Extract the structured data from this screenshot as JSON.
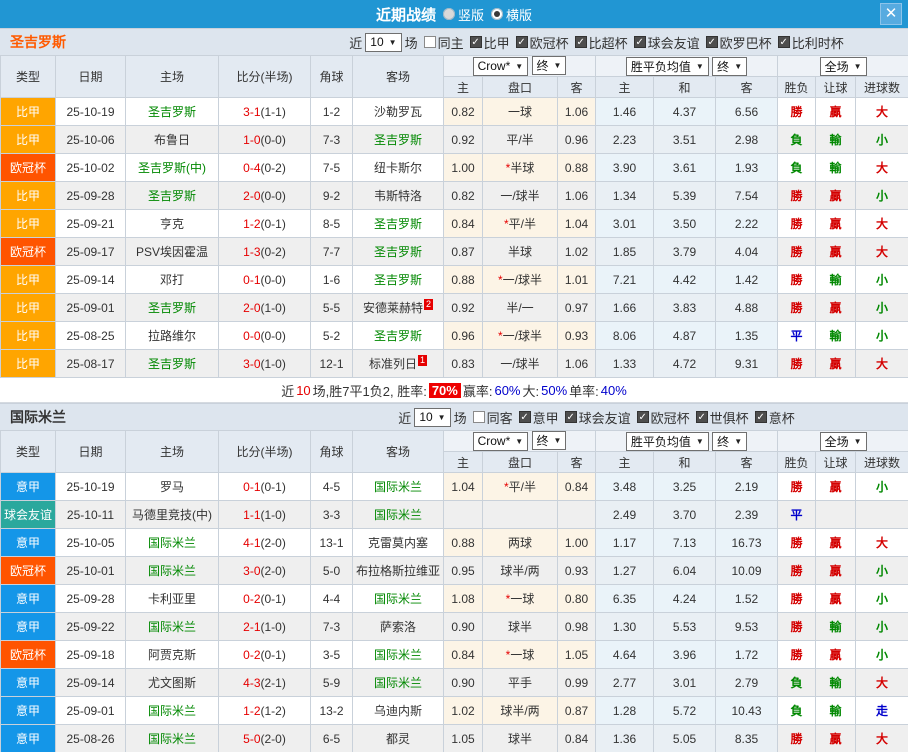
{
  "titlebar": {
    "title": "近期战绩",
    "vertical": "竖版",
    "horizontal": "横版",
    "close": "✕"
  },
  "labels": {
    "near": "近",
    "games": "场"
  },
  "table_header": {
    "cols": [
      "类型",
      "日期",
      "主场",
      "比分(半场)",
      "角球",
      "客场"
    ],
    "sub": [
      "主",
      "盘口",
      "客",
      "主",
      "和",
      "客",
      "胜负",
      "让球",
      "进球数"
    ],
    "crow": "Crow*",
    "final": "终",
    "avg": "胜平负均值",
    "full": "全场"
  },
  "focus_team_color": "#008800",
  "type_colors": {
    "比甲": "#ffa500",
    "欧冠杯": "#ff5400",
    "意甲": "#1496e8",
    "球会友谊": "#2aa89d"
  },
  "result_colors": {
    "勝": "#d40000",
    "負": "#008800",
    "平": "#0000cc",
    "贏": "#d40000",
    "輸": "#008800",
    "大": "#d40000",
    "小": "#008800",
    "走": "#0000cc"
  },
  "sections": [
    {
      "team": "圣吉罗斯",
      "team_color": "#ff5a00",
      "count": "10",
      "same_label": "同主",
      "leagues": [
        "比甲",
        "欧冠杯",
        "比超杯",
        "球会友谊",
        "欧罗巴杯",
        "比利时杯"
      ],
      "rows": [
        {
          "type": "比甲",
          "date": "25-10-19",
          "home": "圣吉罗斯",
          "home_focus": true,
          "ft": "3-1",
          "ht": "(1-1)",
          "corner": "1-2",
          "away": "沙勒罗瓦",
          "away_focus": false,
          "away_badge": "",
          "o1": "0.82",
          "handicap": "一球",
          "o2": "1.06",
          "avg_win": "1.46",
          "avg_draw": "4.37",
          "avg_lose": "6.56",
          "wdl": "勝",
          "let": "贏",
          "goals": "大"
        },
        {
          "type": "比甲",
          "date": "25-10-06",
          "home": "布鲁日",
          "home_focus": false,
          "ft": "1-0",
          "ht": "(0-0)",
          "corner": "7-3",
          "away": "圣吉罗斯",
          "away_focus": true,
          "away_badge": "",
          "o1": "0.92",
          "handicap": "平/半",
          "o2": "0.96",
          "avg_win": "2.23",
          "avg_draw": "3.51",
          "avg_lose": "2.98",
          "wdl": "負",
          "let": "輸",
          "goals": "小"
        },
        {
          "type": "欧冠杯",
          "date": "25-10-02",
          "home": "圣吉罗斯(中)",
          "home_focus": true,
          "ft": "0-4",
          "ht": "(0-2)",
          "corner": "7-5",
          "away": "纽卡斯尔",
          "away_focus": false,
          "away_badge": "",
          "o1": "1.00",
          "handicap": "*半球",
          "o2": "0.88",
          "avg_win": "3.90",
          "avg_draw": "3.61",
          "avg_lose": "1.93",
          "wdl": "負",
          "let": "輸",
          "goals": "大"
        },
        {
          "type": "比甲",
          "date": "25-09-28",
          "home": "圣吉罗斯",
          "home_focus": true,
          "ft": "2-0",
          "ht": "(0-0)",
          "corner": "9-2",
          "away": "韦斯特洛",
          "away_focus": false,
          "away_badge": "",
          "o1": "0.82",
          "handicap": "一/球半",
          "o2": "1.06",
          "avg_win": "1.34",
          "avg_draw": "5.39",
          "avg_lose": "7.54",
          "wdl": "勝",
          "let": "贏",
          "goals": "小"
        },
        {
          "type": "比甲",
          "date": "25-09-21",
          "home": "亨克",
          "home_focus": false,
          "ft": "1-2",
          "ht": "(0-1)",
          "corner": "8-5",
          "away": "圣吉罗斯",
          "away_focus": true,
          "away_badge": "",
          "o1": "0.84",
          "handicap": "*平/半",
          "o2": "1.04",
          "avg_win": "3.01",
          "avg_draw": "3.50",
          "avg_lose": "2.22",
          "wdl": "勝",
          "let": "贏",
          "goals": "大"
        },
        {
          "type": "欧冠杯",
          "date": "25-09-17",
          "home": "PSV埃因霍温",
          "home_focus": false,
          "ft": "1-3",
          "ht": "(0-2)",
          "corner": "7-7",
          "away": "圣吉罗斯",
          "away_focus": true,
          "away_badge": "",
          "o1": "0.87",
          "handicap": "半球",
          "o2": "1.02",
          "avg_win": "1.85",
          "avg_draw": "3.79",
          "avg_lose": "4.04",
          "wdl": "勝",
          "let": "贏",
          "goals": "大"
        },
        {
          "type": "比甲",
          "date": "25-09-14",
          "home": "邓打",
          "home_focus": false,
          "ft": "0-1",
          "ht": "(0-0)",
          "corner": "1-6",
          "away": "圣吉罗斯",
          "away_focus": true,
          "away_badge": "",
          "o1": "0.88",
          "handicap": "*一/球半",
          "o2": "1.01",
          "avg_win": "7.21",
          "avg_draw": "4.42",
          "avg_lose": "1.42",
          "wdl": "勝",
          "let": "輸",
          "goals": "小"
        },
        {
          "type": "比甲",
          "date": "25-09-01",
          "home": "圣吉罗斯",
          "home_focus": true,
          "ft": "2-0",
          "ht": "(1-0)",
          "corner": "5-5",
          "away": "安德莱赫特",
          "away_focus": false,
          "away_badge": "2",
          "o1": "0.92",
          "handicap": "半/一",
          "o2": "0.97",
          "avg_win": "1.66",
          "avg_draw": "3.83",
          "avg_lose": "4.88",
          "wdl": "勝",
          "let": "贏",
          "goals": "小"
        },
        {
          "type": "比甲",
          "date": "25-08-25",
          "home": "拉路维尔",
          "home_focus": false,
          "ft": "0-0",
          "ht": "(0-0)",
          "corner": "5-2",
          "away": "圣吉罗斯",
          "away_focus": true,
          "away_badge": "",
          "o1": "0.96",
          "handicap": "*一/球半",
          "o2": "0.93",
          "avg_win": "8.06",
          "avg_draw": "4.87",
          "avg_lose": "1.35",
          "wdl": "平",
          "let": "輸",
          "goals": "小"
        },
        {
          "type": "比甲",
          "date": "25-08-17",
          "home": "圣吉罗斯",
          "home_focus": true,
          "ft": "3-0",
          "ht": "(1-0)",
          "corner": "12-1",
          "away": "标准列日",
          "away_focus": false,
          "away_badge": "1",
          "o1": "0.83",
          "handicap": "一/球半",
          "o2": "1.06",
          "avg_win": "1.33",
          "avg_draw": "4.72",
          "avg_lose": "9.31",
          "wdl": "勝",
          "let": "贏",
          "goals": "大"
        }
      ],
      "summary": {
        "pre": "近",
        "count": "10",
        "mid": "场,胜7平1负2, 胜率:",
        "rate": "70%",
        "win_label": "赢率:",
        "win": "60%",
        "big_label": "大:",
        "big": "50%",
        "single_label": "单率:",
        "single": "40%"
      }
    },
    {
      "team": "国际米兰",
      "team_color": "#333333",
      "count": "10",
      "same_label": "同客",
      "leagues": [
        "意甲",
        "球会友谊",
        "欧冠杯",
        "世俱杯",
        "意杯"
      ],
      "rows": [
        {
          "type": "意甲",
          "date": "25-10-19",
          "home": "罗马",
          "home_focus": false,
          "ft": "0-1",
          "ht": "(0-1)",
          "corner": "4-5",
          "away": "国际米兰",
          "away_focus": true,
          "away_badge": "",
          "o1": "1.04",
          "handicap": "*平/半",
          "o2": "0.84",
          "avg_win": "3.48",
          "avg_draw": "3.25",
          "avg_lose": "2.19",
          "wdl": "勝",
          "let": "贏",
          "goals": "小"
        },
        {
          "type": "球会友谊",
          "date": "25-10-11",
          "home": "马德里竞技(中)",
          "home_focus": false,
          "ft": "1-1",
          "ht": "(1-0)",
          "corner": "3-3",
          "away": "国际米兰",
          "away_focus": true,
          "away_badge": "",
          "o1": "",
          "handicap": "",
          "o2": "",
          "avg_win": "2.49",
          "avg_draw": "3.70",
          "avg_lose": "2.39",
          "wdl": "平",
          "let": "",
          "goals": ""
        },
        {
          "type": "意甲",
          "date": "25-10-05",
          "home": "国际米兰",
          "home_focus": true,
          "ft": "4-1",
          "ht": "(2-0)",
          "corner": "13-1",
          "away": "克雷莫内塞",
          "away_focus": false,
          "away_badge": "",
          "o1": "0.88",
          "handicap": "两球",
          "o2": "1.00",
          "avg_win": "1.17",
          "avg_draw": "7.13",
          "avg_lose": "16.73",
          "wdl": "勝",
          "let": "贏",
          "goals": "大"
        },
        {
          "type": "欧冠杯",
          "date": "25-10-01",
          "home": "国际米兰",
          "home_focus": true,
          "ft": "3-0",
          "ht": "(2-0)",
          "corner": "5-0",
          "away": "布拉格斯拉维亚",
          "away_focus": false,
          "away_badge": "",
          "o1": "0.95",
          "handicap": "球半/两",
          "o2": "0.93",
          "avg_win": "1.27",
          "avg_draw": "6.04",
          "avg_lose": "10.09",
          "wdl": "勝",
          "let": "贏",
          "goals": "小"
        },
        {
          "type": "意甲",
          "date": "25-09-28",
          "home": "卡利亚里",
          "home_focus": false,
          "ft": "0-2",
          "ht": "(0-1)",
          "corner": "4-4",
          "away": "国际米兰",
          "away_focus": true,
          "away_badge": "",
          "o1": "1.08",
          "handicap": "*一球",
          "o2": "0.80",
          "avg_win": "6.35",
          "avg_draw": "4.24",
          "avg_lose": "1.52",
          "wdl": "勝",
          "let": "贏",
          "goals": "小"
        },
        {
          "type": "意甲",
          "date": "25-09-22",
          "home": "国际米兰",
          "home_focus": true,
          "ft": "2-1",
          "ht": "(1-0)",
          "corner": "7-3",
          "away": "萨索洛",
          "away_focus": false,
          "away_badge": "",
          "o1": "0.90",
          "handicap": "球半",
          "o2": "0.98",
          "avg_win": "1.30",
          "avg_draw": "5.53",
          "avg_lose": "9.53",
          "wdl": "勝",
          "let": "輸",
          "goals": "小"
        },
        {
          "type": "欧冠杯",
          "date": "25-09-18",
          "home": "阿贾克斯",
          "home_focus": false,
          "ft": "0-2",
          "ht": "(0-1)",
          "corner": "3-5",
          "away": "国际米兰",
          "away_focus": true,
          "away_badge": "",
          "o1": "0.84",
          "handicap": "*一球",
          "o2": "1.05",
          "avg_win": "4.64",
          "avg_draw": "3.96",
          "avg_lose": "1.72",
          "wdl": "勝",
          "let": "贏",
          "goals": "小"
        },
        {
          "type": "意甲",
          "date": "25-09-14",
          "home": "尤文图斯",
          "home_focus": false,
          "ft": "4-3",
          "ht": "(2-1)",
          "corner": "5-9",
          "away": "国际米兰",
          "away_focus": true,
          "away_badge": "",
          "o1": "0.90",
          "handicap": "平手",
          "o2": "0.99",
          "avg_win": "2.77",
          "avg_draw": "3.01",
          "avg_lose": "2.79",
          "wdl": "負",
          "let": "輸",
          "goals": "大"
        },
        {
          "type": "意甲",
          "date": "25-09-01",
          "home": "国际米兰",
          "home_focus": true,
          "ft": "1-2",
          "ht": "(1-2)",
          "corner": "13-2",
          "away": "乌迪内斯",
          "away_focus": false,
          "away_badge": "",
          "o1": "1.02",
          "handicap": "球半/两",
          "o2": "0.87",
          "avg_win": "1.28",
          "avg_draw": "5.72",
          "avg_lose": "10.43",
          "wdl": "負",
          "let": "輸",
          "goals": "走"
        },
        {
          "type": "意甲",
          "date": "25-08-26",
          "home": "国际米兰",
          "home_focus": true,
          "ft": "5-0",
          "ht": "(2-0)",
          "corner": "6-5",
          "away": "都灵",
          "away_focus": false,
          "away_badge": "",
          "o1": "1.05",
          "handicap": "球半",
          "o2": "0.84",
          "avg_win": "1.36",
          "avg_draw": "5.05",
          "avg_lose": "8.35",
          "wdl": "勝",
          "let": "贏",
          "goals": "大"
        }
      ]
    }
  ]
}
